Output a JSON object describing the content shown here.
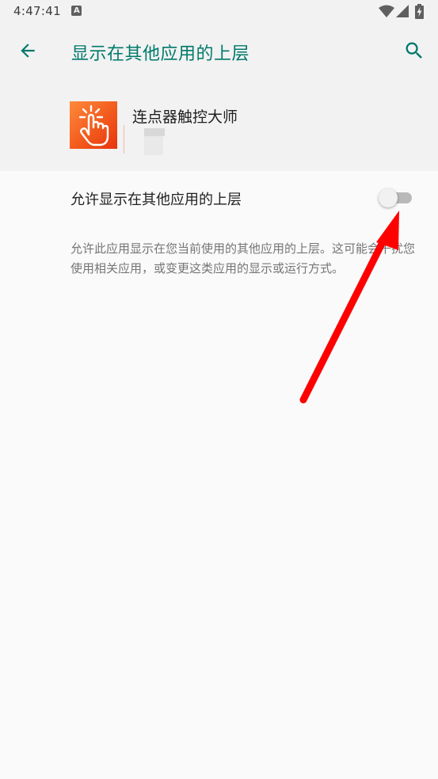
{
  "status_bar": {
    "time": "4:47:41",
    "icons": [
      "accessibility-a-icon",
      "wifi-icon",
      "signal-icon",
      "battery-charging-icon"
    ]
  },
  "app_bar": {
    "title": "显示在其他应用的上层",
    "back_icon": "arrow-left-icon",
    "search_icon": "search-icon"
  },
  "app_info": {
    "name": "连点器触控大师",
    "icon": "tap-hand-icon"
  },
  "permission": {
    "label": "允许显示在其他应用的上层",
    "enabled": false
  },
  "description": "允许此应用显示在您当前使用的其他应用的上层。这可能会干扰您使用相关应用，或变更这类应用的显示或运行方式。",
  "colors": {
    "accent": "#00796b",
    "header_bg": "#f2f2f2",
    "page_bg": "#fafafa",
    "app_icon_orange": "#f25a1d",
    "annotation_red": "#ff0000"
  }
}
